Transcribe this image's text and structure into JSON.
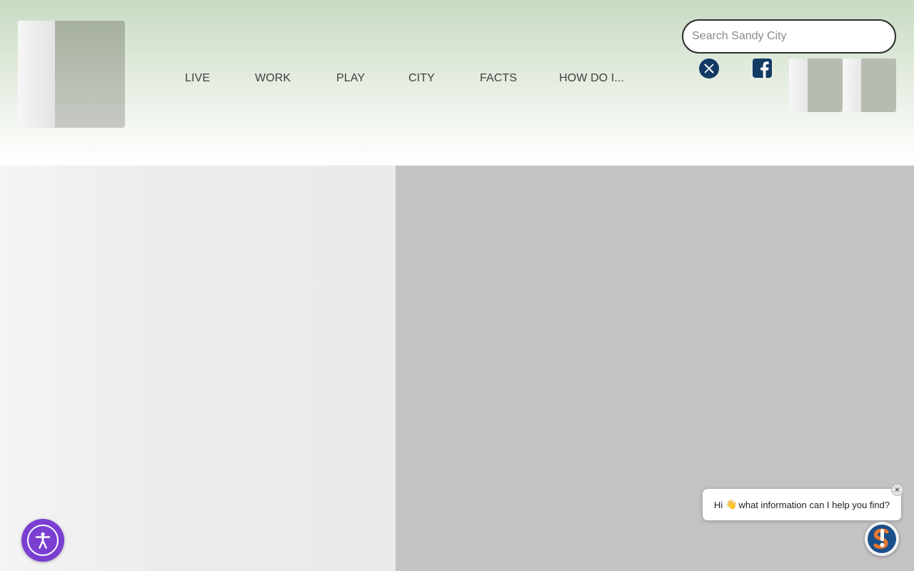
{
  "header": {
    "nav": [
      "LIVE",
      "WORK",
      "PLAY",
      "CITY",
      "FACTS",
      "HOW DO I..."
    ],
    "search": {
      "placeholder": "Search Sandy City",
      "value": ""
    },
    "social": [
      {
        "icon": "x-twitter-icon",
        "color": "#123a64"
      },
      {
        "icon": "facebook-icon",
        "color": "#123a64"
      }
    ]
  },
  "chat": {
    "greeting_before": "Hi",
    "greeting_emoji": "👋",
    "greeting_after": "what information can I help you find?",
    "close_symbol": "×",
    "brand_colors": {
      "primary": "#1b4f8a",
      "accent": "#e8772e"
    }
  },
  "accessibility": {
    "icon": "accessibility-icon",
    "color": "#7a3fd1"
  },
  "colors": {
    "header_top": "#c8dbc2",
    "hero_right": "#c3c3c3",
    "hero_left": "#ececec"
  }
}
